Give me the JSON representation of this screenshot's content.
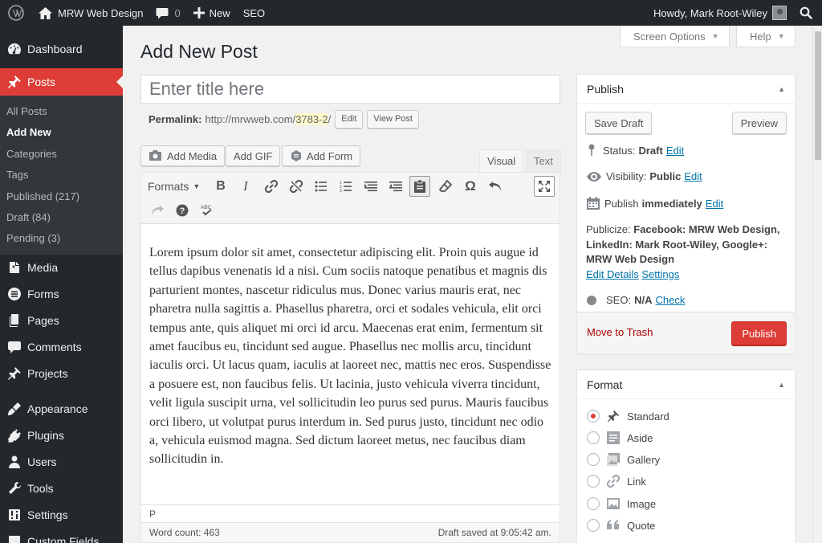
{
  "adminbar": {
    "site_name": "MRW Web Design",
    "comments_count": "0",
    "new_label": "New",
    "seo_label": "SEO",
    "howdy": "Howdy, Mark Root-Wiley"
  },
  "sidebar": {
    "items": [
      {
        "label": "Dashboard",
        "icon": "dashboard-icon"
      },
      {
        "label": "Posts",
        "icon": "pin-icon"
      },
      {
        "label": "Media",
        "icon": "media-icon"
      },
      {
        "label": "Forms",
        "icon": "forms-icon"
      },
      {
        "label": "Pages",
        "icon": "pages-icon"
      },
      {
        "label": "Comments",
        "icon": "comments-icon"
      },
      {
        "label": "Projects",
        "icon": "pin-icon"
      },
      {
        "label": "Appearance",
        "icon": "brush-icon"
      },
      {
        "label": "Plugins",
        "icon": "plugin-icon"
      },
      {
        "label": "Users",
        "icon": "users-icon"
      },
      {
        "label": "Tools",
        "icon": "wrench-icon"
      },
      {
        "label": "Settings",
        "icon": "settings-icon"
      },
      {
        "label": "Custom Fields",
        "icon": "custom-fields-icon"
      }
    ],
    "submenu": [
      "All Posts",
      "Add New",
      "Categories",
      "Tags",
      "Published (217)",
      "Draft (84)",
      "Pending (3)"
    ]
  },
  "screen_options": "Screen Options",
  "help": "Help",
  "page_title": "Add New Post",
  "title_placeholder": "Enter title here",
  "permalink": {
    "label": "Permalink:",
    "base": "http://mrwweb.com/",
    "slug": "3783-2",
    "trailing": "/",
    "edit": "Edit",
    "view": "View Post"
  },
  "media_buttons": [
    "Add Media",
    "Add GIF",
    "Add Form"
  ],
  "editor_tabs": {
    "visual": "Visual",
    "text": "Text"
  },
  "toolbar": {
    "formats": "Formats"
  },
  "content": {
    "paragraph1": "Lorem ipsum dolor sit amet, consectetur adipiscing elit. Proin quis augue id tellus dapibus venenatis id a nisi. Cum sociis natoque penatibus et magnis dis parturient montes, nascetur ridiculus mus. Donec varius mauris erat, nec pharetra nulla sagittis a. Phasellus pharetra, orci et sodales vehicula, elit orci tempus ante, quis aliquet mi orci id arcu. Maecenas erat enim, fermentum sit amet faucibus eu, tincidunt sed augue. Phasellus nec mollis arcu, tincidunt iaculis orci. Ut lacus quam, iaculis at laoreet nec, mattis nec eros. Suspendisse a posuere est, non faucibus felis. Ut lacinia, justo vehicula viverra tincidunt, velit ligula suscipit urna, vel sollicitudin leo purus sed purus. Mauris faucibus orci libero, ut volutpat purus interdum in. Sed purus justo, tincidunt nec odio a, vehicula euismod magna. Sed dictum laoreet metus, nec faucibus diam sollicitudin in.",
    "path": "P",
    "word_count": "Word count: 463",
    "draft_saved": "Draft saved at 9:05:42 am."
  },
  "publish_box": {
    "title": "Publish",
    "save_draft": "Save Draft",
    "preview": "Preview",
    "status_label": "Status:",
    "status_value": "Draft",
    "visibility_label": "Visibility:",
    "visibility_value": "Public",
    "publish_label": "Publish",
    "publish_value": "immediately",
    "edit": "Edit",
    "publicize_label": "Publicize:",
    "publicize_value": "Facebook: MRW Web Design, LinkedIn: Mark Root-Wiley, Google+: MRW Web Design",
    "edit_details": "Edit Details",
    "settings": "Settings",
    "seo_label": "SEO:",
    "seo_value": "N/A",
    "check": "Check",
    "move_to_trash": "Move to Trash",
    "publish_button": "Publish"
  },
  "format_box": {
    "title": "Format",
    "options": [
      {
        "label": "Standard",
        "icon": "pin-icon",
        "selected": true
      },
      {
        "label": "Aside",
        "icon": "aside-icon",
        "selected": false
      },
      {
        "label": "Gallery",
        "icon": "gallery-icon",
        "selected": false
      },
      {
        "label": "Link",
        "icon": "link-icon",
        "selected": false
      },
      {
        "label": "Image",
        "icon": "image-icon",
        "selected": false
      },
      {
        "label": "Quote",
        "icon": "quote-icon",
        "selected": false
      }
    ]
  },
  "colors": {
    "accent": "#dd3d36",
    "admin_bg": "#23282d",
    "link": "#0073aa"
  }
}
